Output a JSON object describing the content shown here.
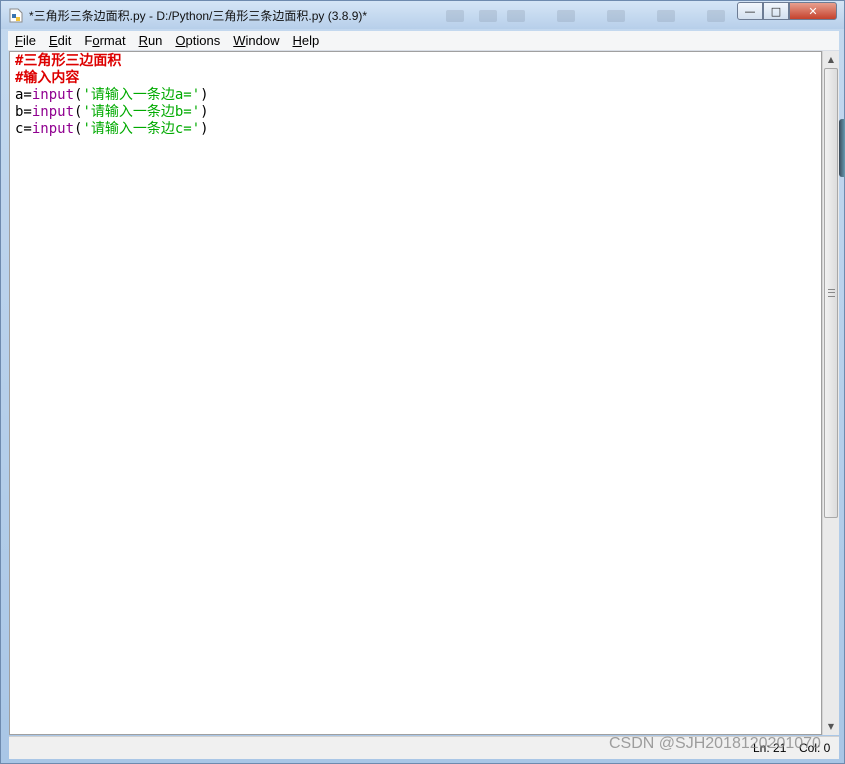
{
  "window": {
    "title": "*三角形三条边面积.py - D:/Python/三角形三条边面积.py (3.8.9)*",
    "controls": {
      "minimize": "—",
      "maximize": "□",
      "close": "✕"
    }
  },
  "menu": {
    "items": [
      {
        "accel": "F",
        "rest": "ile"
      },
      {
        "accel": "E",
        "rest": "dit"
      },
      {
        "accel": "",
        "pre": "F",
        "accel2": "o",
        "rest": "rmat"
      },
      {
        "accel": "R",
        "rest": "un"
      },
      {
        "accel": "O",
        "rest": "ptions"
      },
      {
        "accel": "W",
        "rest": "indow"
      },
      {
        "accel": "H",
        "rest": "elp"
      }
    ]
  },
  "editor": {
    "lines": {
      "l1": {
        "comment": "#三角形三边面积"
      },
      "l2": {
        "comment": "#输入内容"
      },
      "l3": {
        "var": "a=",
        "fn": "input",
        "open": "(",
        "str": "'请输入一条边a='",
        "close": ")"
      },
      "l4": {
        "var": "b=",
        "fn": "input",
        "open": "(",
        "str": "'请输入一条边b='",
        "close": ")"
      },
      "l5": {
        "var": "c=",
        "fn": "input",
        "open": "(",
        "str": "'请输入一条边c='",
        "close": ")"
      }
    }
  },
  "status": {
    "ln": "Ln: 21",
    "col": "Col: 0"
  },
  "watermark": "CSDN @SJH2018120201070",
  "colors": {
    "comment": "#dd0000",
    "builtin": "#900090",
    "string": "#00aa00"
  }
}
